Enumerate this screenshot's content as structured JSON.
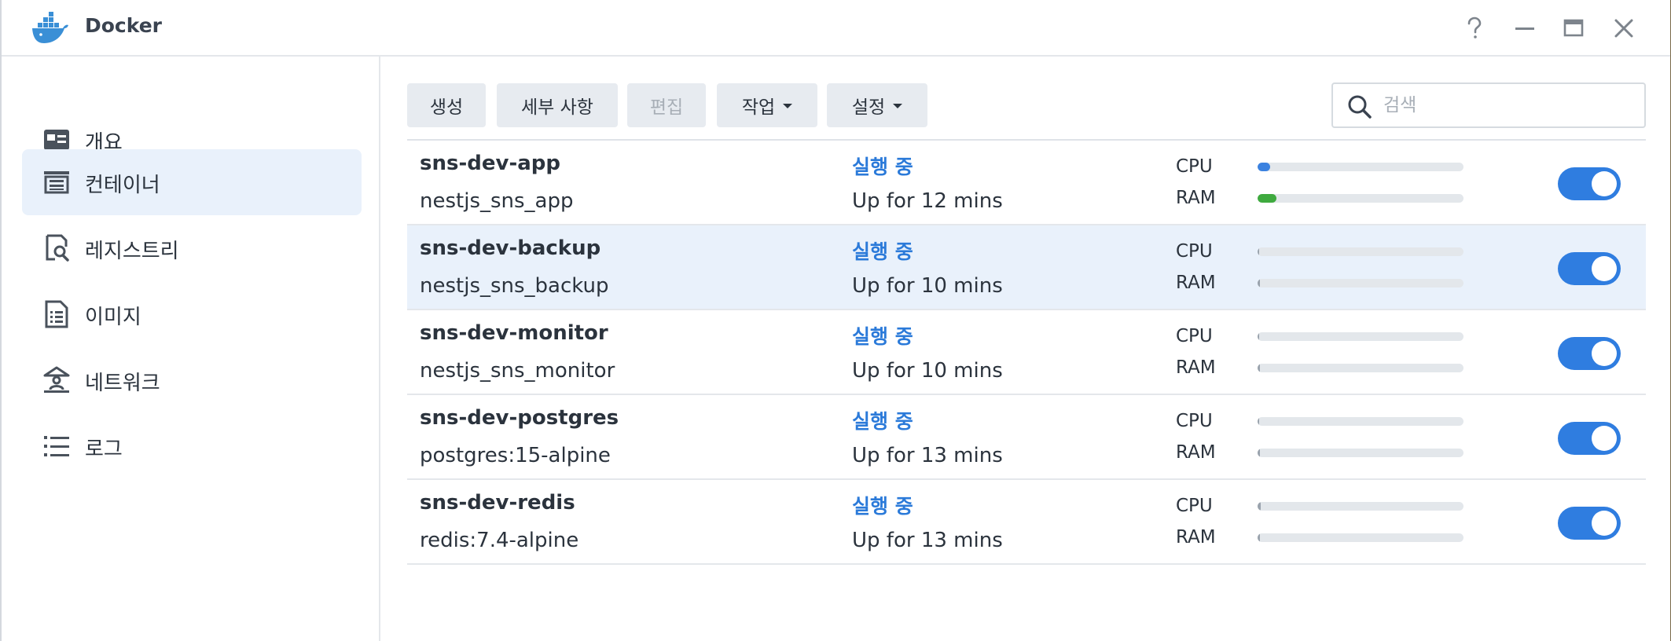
{
  "app": {
    "title": "Docker"
  },
  "window_controls": {
    "help": "?",
    "minimize": "—",
    "maximize": "▭",
    "close": "✕"
  },
  "sidebar": {
    "items": [
      {
        "label": "개요",
        "icon": "overview-icon",
        "active": false
      },
      {
        "label": "컨테이너",
        "icon": "container-icon",
        "active": true
      },
      {
        "label": "레지스트리",
        "icon": "registry-icon",
        "active": false
      },
      {
        "label": "이미지",
        "icon": "image-icon",
        "active": false
      },
      {
        "label": "네트워크",
        "icon": "network-icon",
        "active": false
      },
      {
        "label": "로그",
        "icon": "log-icon",
        "active": false
      }
    ]
  },
  "toolbar": {
    "create": "생성",
    "details": "세부 사항",
    "edit": "편집",
    "action": "작업",
    "settings": "설정",
    "search_placeholder": "검색"
  },
  "colors": {
    "accent": "#2f7de0",
    "status": "#2b7ad9",
    "cpu_fill": "#3b82e0",
    "ram_fill": "#3faa3f",
    "selected_row": "#e9f1fb"
  },
  "containers": [
    {
      "name": "sns-dev-app",
      "image": "nestjs_sns_app",
      "status": "실행 중",
      "uptime": "Up for 12 mins",
      "cpu_label": "CPU",
      "ram_label": "RAM",
      "cpu": 0.06,
      "ram": 0.09,
      "enabled": true,
      "selected": false
    },
    {
      "name": "sns-dev-backup",
      "image": "nestjs_sns_backup",
      "status": "실행 중",
      "uptime": "Up for 10 mins",
      "cpu_label": "CPU",
      "ram_label": "RAM",
      "cpu": 0.0,
      "ram": 0.01,
      "enabled": true,
      "selected": true
    },
    {
      "name": "sns-dev-monitor",
      "image": "nestjs_sns_monitor",
      "status": "실행 중",
      "uptime": "Up for 10 mins",
      "cpu_label": "CPU",
      "ram_label": "RAM",
      "cpu": 0.0,
      "ram": 0.01,
      "enabled": true,
      "selected": false
    },
    {
      "name": "sns-dev-postgres",
      "image": "postgres:15-alpine",
      "status": "실행 중",
      "uptime": "Up for 13 mins",
      "cpu_label": "CPU",
      "ram_label": "RAM",
      "cpu": 0.0,
      "ram": 0.01,
      "enabled": true,
      "selected": false
    },
    {
      "name": "sns-dev-redis",
      "image": "redis:7.4-alpine",
      "status": "실행 중",
      "uptime": "Up for 13 mins",
      "cpu_label": "CPU",
      "ram_label": "RAM",
      "cpu": 0.01,
      "ram": 0.01,
      "enabled": true,
      "selected": false
    }
  ]
}
